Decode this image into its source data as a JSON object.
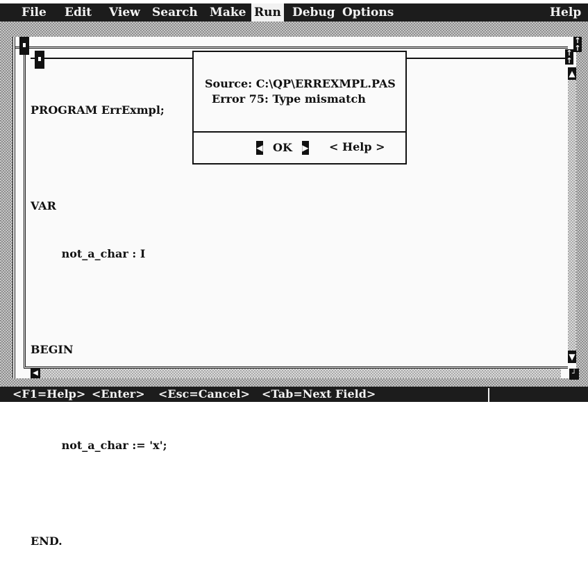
{
  "menu": {
    "items": [
      "File",
      "Edit",
      "View",
      "Search",
      "Make",
      "Run",
      "Debug",
      "Options"
    ],
    "help": "Help",
    "selected": "Run"
  },
  "editor": {
    "code": {
      "line1": "PROGRAM ErrExmpl;",
      "line2": "VAR",
      "line3": "        not_a_char : I",
      "line4": "BEGIN",
      "line5": "        not_a_char := 'x';",
      "line6": "END."
    }
  },
  "dialog": {
    "source": "Source: C:\\QP\\ERREXMPL.PAS",
    "error": "Error 75: Type mismatch",
    "ok_label": "OK",
    "help_label": "< Help >"
  },
  "statusbar": {
    "hints": [
      "<F1=Help>",
      "<Enter>",
      "<Esc=Cancel>",
      "<Tab=Next Field>"
    ]
  },
  "icons": {
    "close": "close-box-icon",
    "scroll_up": "up-arrow-icon",
    "scroll_down": "down-arrow-icon",
    "scroll_left": "left-arrow-icon",
    "resize": "resize-corner-icon"
  },
  "colors": {
    "menubar_bg": "#1c1c1c",
    "menubar_fg": "#f2f2f2",
    "window_bg": "#fafafa",
    "dither_dark": "#8d8d8d",
    "dither_light": "#c8c8c8"
  }
}
